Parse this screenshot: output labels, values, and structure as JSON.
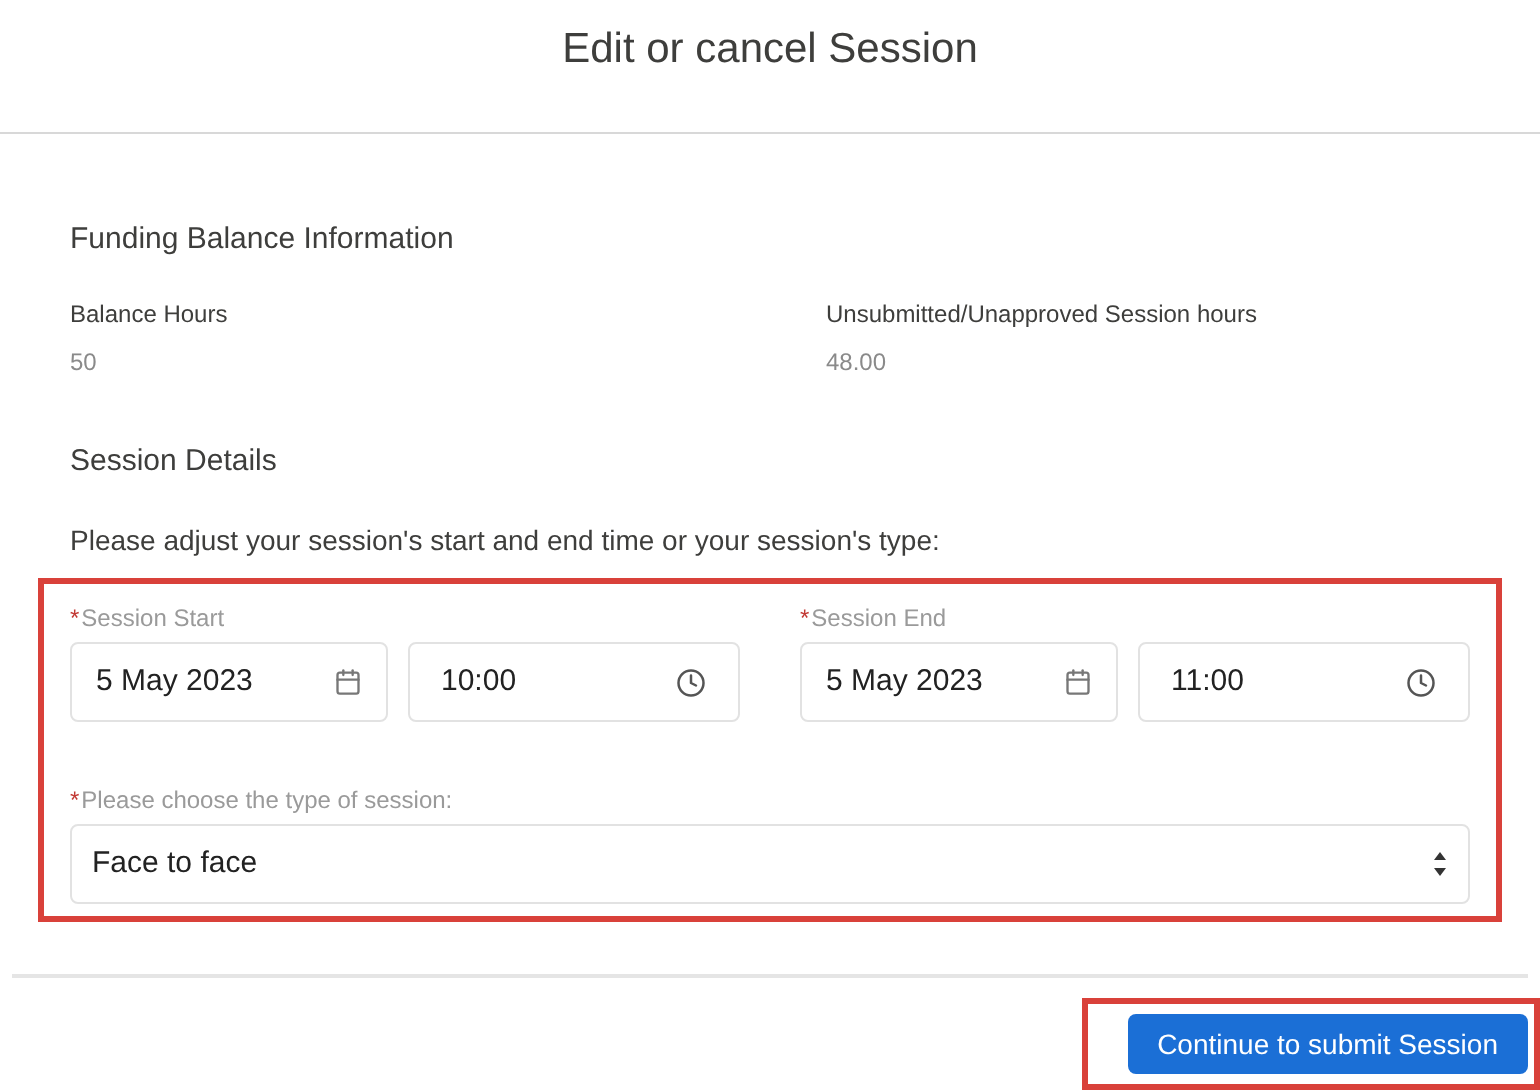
{
  "title": "Edit or cancel Session",
  "funding": {
    "heading": "Funding Balance Information",
    "fields": [
      {
        "label": "Balance Hours",
        "value": "50"
      },
      {
        "label": "Unsubmitted/Unapproved Session hours",
        "value": "48.00"
      }
    ]
  },
  "session": {
    "heading": "Session Details",
    "instruction": "Please adjust your session's start and end time or your session's type:",
    "ranges": [
      {
        "label": "Session Start",
        "required": true,
        "date": "5 May 2023",
        "time": "10:00"
      },
      {
        "label": "Session End",
        "required": true,
        "date": "5 May 2023",
        "time": "11:00"
      }
    ],
    "type_select": {
      "label": "Please choose the type of session:",
      "required": true,
      "value": "Face to face"
    }
  },
  "submit_button": "Continue to submit Session",
  "required_mark": "*"
}
